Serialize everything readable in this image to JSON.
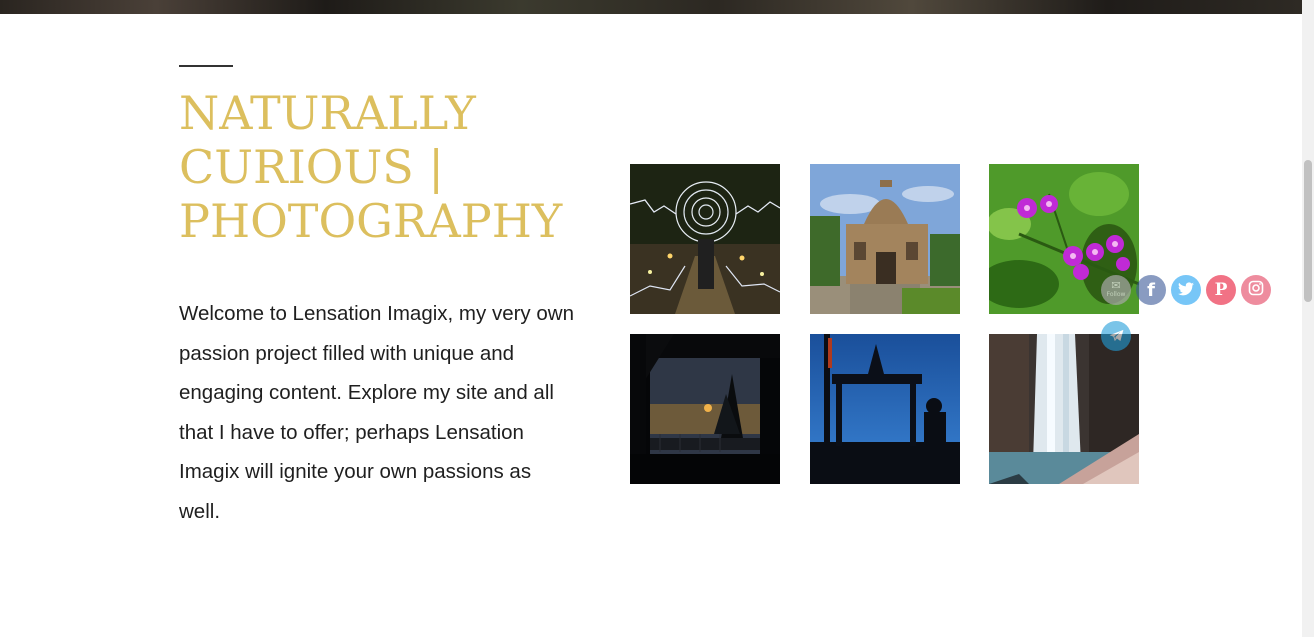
{
  "hero": {
    "title_lines": [
      "NATURALLY",
      "CURIOUS |",
      "PHOTOGRAPHY"
    ],
    "intro": "Welcome to Lensation Imagix, my very own passion project filled with unique and engaging content. Explore my site and all that I have to offer; perhaps Lensation Imagix will ignite your own passions as well."
  },
  "gallery": {
    "items": [
      {
        "icon": "light-painting-photo"
      },
      {
        "icon": "tomb-monument-photo"
      },
      {
        "icon": "pink-flowers-photo"
      },
      {
        "icon": "sunset-silhouette-photo"
      },
      {
        "icon": "temple-silhouette-photo"
      },
      {
        "icon": "waterfall-photo"
      }
    ]
  },
  "social": {
    "follow_label": "Follow",
    "buttons": [
      {
        "icon": "email-follow-icon",
        "color": "#9e9e9e"
      },
      {
        "icon": "facebook-icon",
        "color": "#3b5998"
      },
      {
        "icon": "twitter-icon",
        "color": "#1da1f2"
      },
      {
        "icon": "pinterest-icon",
        "color": "#e60023"
      },
      {
        "icon": "instagram-icon",
        "color": "#e4405f"
      },
      {
        "icon": "telegram-icon",
        "color": "#229ed9"
      }
    ]
  },
  "colors": {
    "title": "#dcbf5e",
    "text": "#1f1f1f"
  }
}
